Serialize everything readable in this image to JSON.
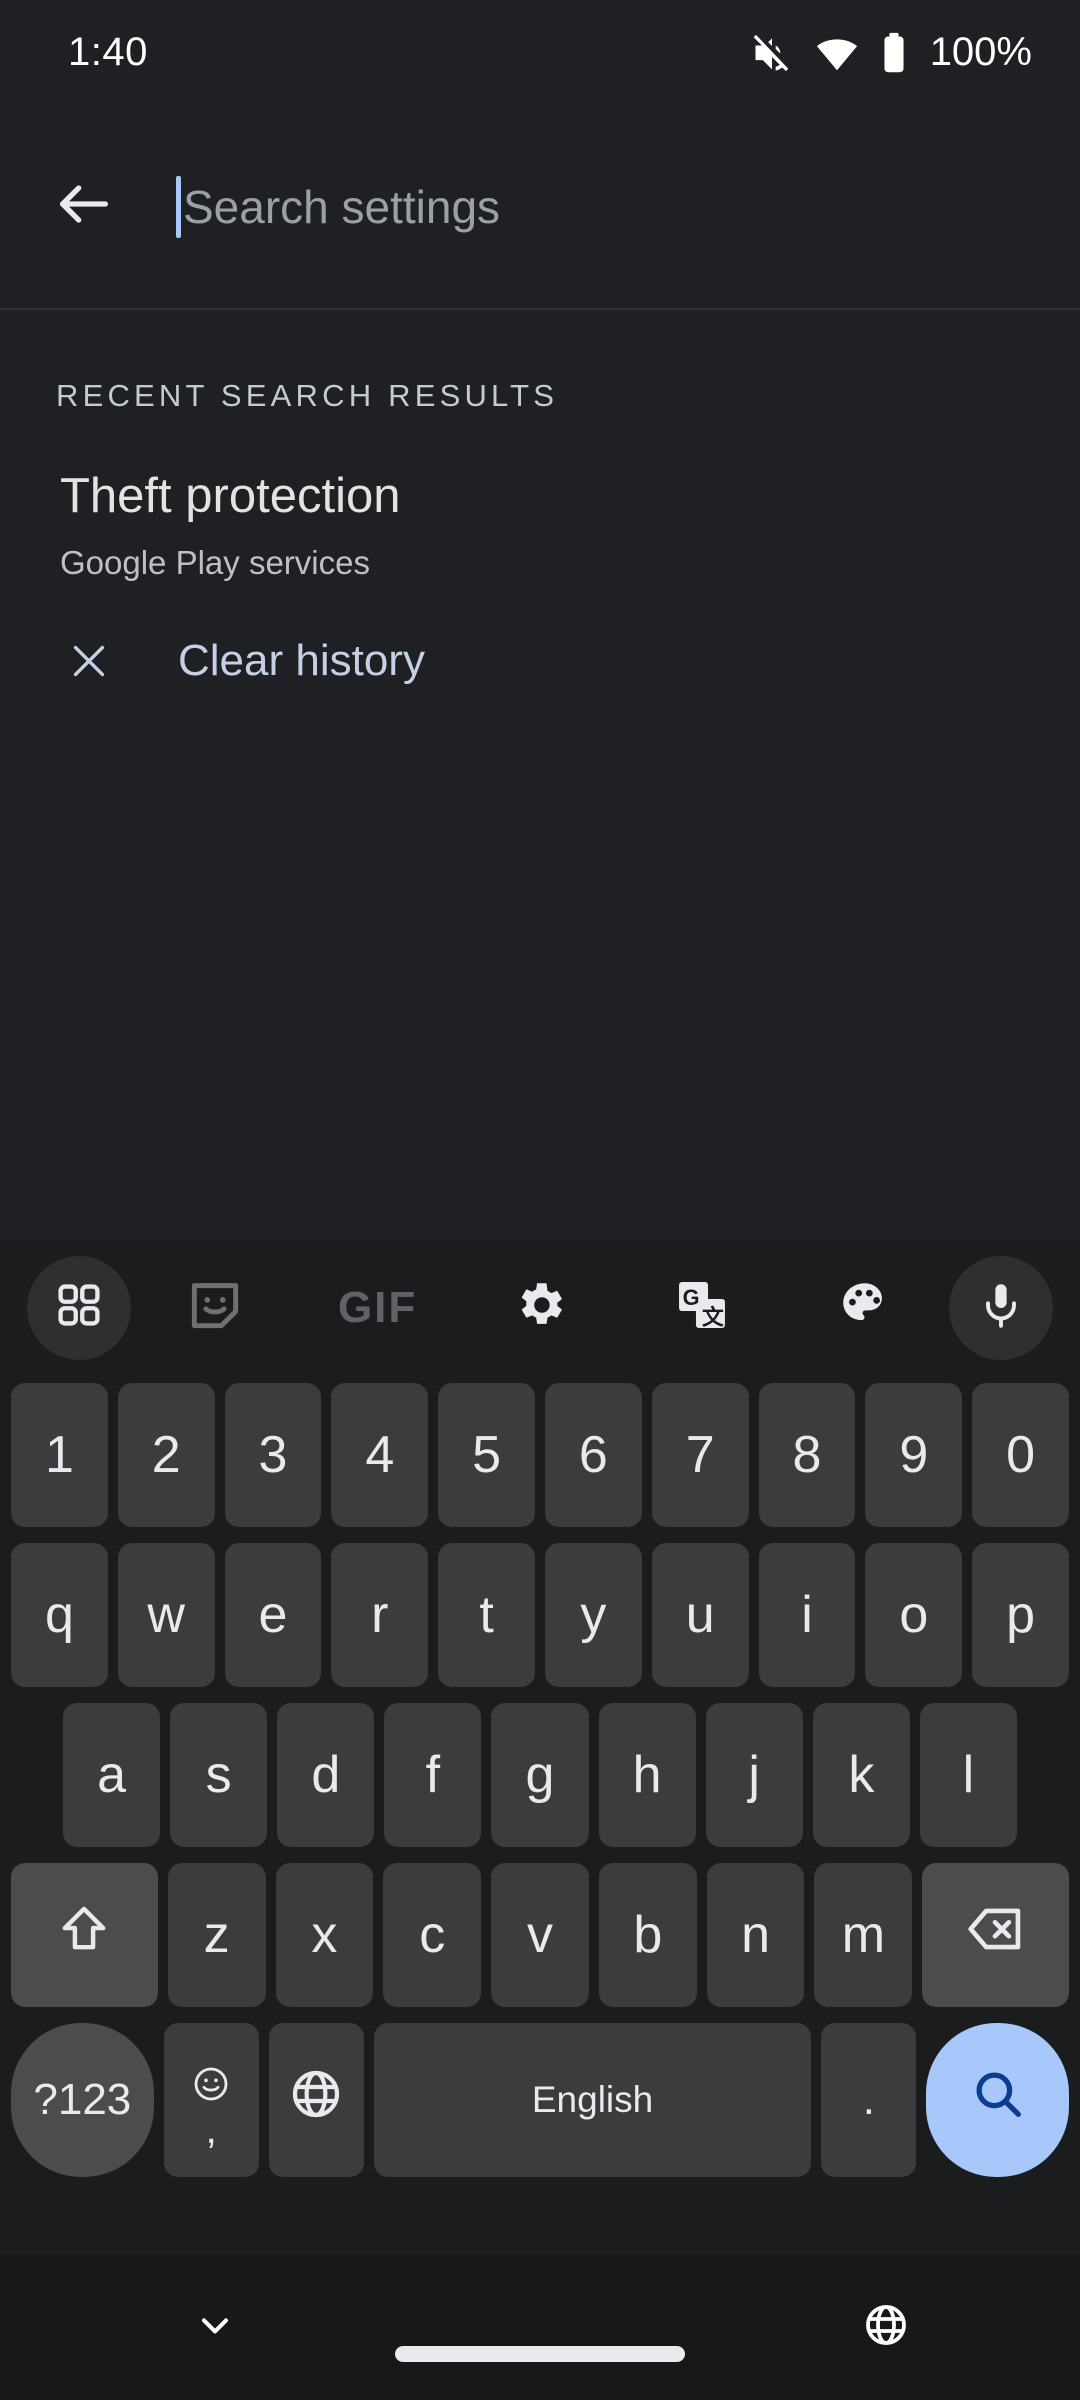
{
  "statusbar": {
    "time": "1:40",
    "battery_percent": "100%",
    "icons": [
      "volume-mute-icon",
      "wifi-icon",
      "battery-full-icon"
    ]
  },
  "searchbar": {
    "back_icon": "arrow-back-icon",
    "placeholder": "Search settings",
    "value": "",
    "caret_color": "#A8C7FA"
  },
  "content": {
    "section_header": "RECENT SEARCH RESULTS",
    "results": [
      {
        "title": "Theft protection",
        "subtitle": "Google Play services"
      }
    ],
    "clear_history": {
      "icon": "close-icon",
      "label": "Clear history",
      "color": "#C5D0E6"
    }
  },
  "keyboard": {
    "toolbar": [
      {
        "name": "apps-grid-icon",
        "label": "",
        "circled": true
      },
      {
        "name": "sticker-icon",
        "label": "",
        "circled": false
      },
      {
        "name": "gif-icon",
        "label": "GIF",
        "circled": false
      },
      {
        "name": "settings-gear-icon",
        "label": "",
        "circled": false
      },
      {
        "name": "translate-icon",
        "label": "",
        "circled": false
      },
      {
        "name": "theme-palette-icon",
        "label": "",
        "circled": false
      },
      {
        "name": "microphone-icon",
        "label": "",
        "circled": true
      }
    ],
    "rows": {
      "numbers": [
        "1",
        "2",
        "3",
        "4",
        "5",
        "6",
        "7",
        "8",
        "9",
        "0"
      ],
      "top": [
        "q",
        "w",
        "e",
        "r",
        "t",
        "y",
        "u",
        "i",
        "o",
        "p"
      ],
      "home": [
        "a",
        "s",
        "d",
        "f",
        "g",
        "h",
        "j",
        "k",
        "l"
      ],
      "bottom": [
        "z",
        "x",
        "c",
        "v",
        "b",
        "n",
        "m"
      ]
    },
    "shift_key": {
      "label": "",
      "icon": "shift-arrow-icon"
    },
    "backspace_key": {
      "label": "",
      "icon": "backspace-icon"
    },
    "symbols_key": {
      "label": "?123"
    },
    "comma_key": {
      "emoji_icon": "emoji-smiley-icon",
      "glyph": ","
    },
    "language_key": {
      "icon": "globe-icon"
    },
    "spacebar": {
      "label": "English"
    },
    "period_key": {
      "glyph": "."
    },
    "enter_key": {
      "icon": "search-icon",
      "bg": "#A8C7FA",
      "fg": "#0B3D91"
    }
  },
  "navbar": {
    "hide_keyboard_icon": "chevron-down-icon",
    "gesture_pill": "home-pill",
    "language_icon": "globe-icon"
  }
}
